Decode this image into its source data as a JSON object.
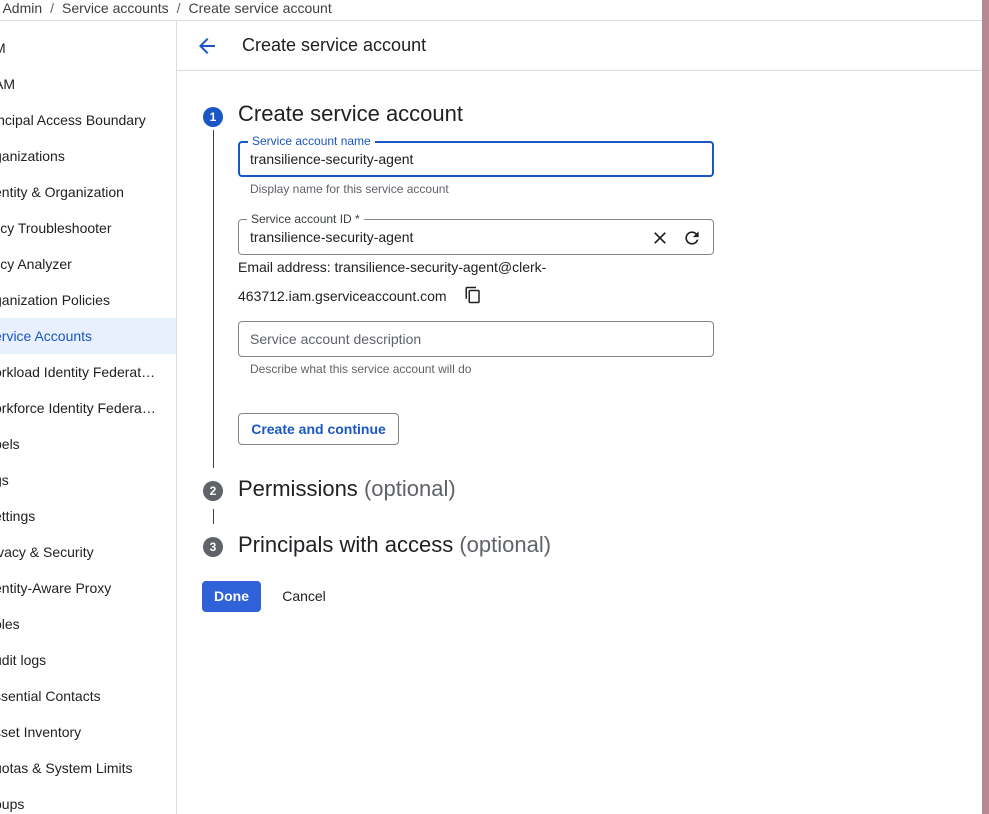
{
  "breadcrumb": {
    "items": [
      "& Admin",
      "Service accounts",
      "Create service account"
    ],
    "separator": "/"
  },
  "sidebar": {
    "items": [
      {
        "label": "M",
        "active": false
      },
      {
        "label": "AM",
        "active": false
      },
      {
        "label": "incipal Access Boundary",
        "active": false
      },
      {
        "label": "ganizations",
        "active": false
      },
      {
        "label": "entity & Organization",
        "active": false
      },
      {
        "label": "licy Troubleshooter",
        "active": false
      },
      {
        "label": "licy Analyzer",
        "active": false
      },
      {
        "label": "ganization Policies",
        "active": false
      },
      {
        "label": "ervice Accounts",
        "active": true
      },
      {
        "label": "orkload Identity Federat…",
        "active": false
      },
      {
        "label": "orkforce Identity Federa…",
        "active": false
      },
      {
        "label": "bels",
        "active": false
      },
      {
        "label": "gs",
        "active": false
      },
      {
        "label": "ettings",
        "active": false
      },
      {
        "label": "ivacy & Security",
        "active": false
      },
      {
        "label": "entity-Aware Proxy",
        "active": false
      },
      {
        "label": "oles",
        "active": false
      },
      {
        "label": "udit logs",
        "active": false
      },
      {
        "label": "ssential Contacts",
        "active": false
      },
      {
        "label": "sset Inventory",
        "active": false
      },
      {
        "label": "uotas & System Limits",
        "active": false
      },
      {
        "label": "oups",
        "active": false
      }
    ]
  },
  "header": {
    "back_icon": "arrow-back-icon",
    "title": "Create service account"
  },
  "steps": [
    {
      "number": "1",
      "title": "Create service account",
      "optional": "",
      "active": true
    },
    {
      "number": "2",
      "title": "Permissions",
      "optional": "(optional)",
      "active": false
    },
    {
      "number": "3",
      "title": "Principals with access",
      "optional": "(optional)",
      "active": false
    }
  ],
  "form": {
    "name_field": {
      "label": "Service account name",
      "value": "transilience-security-agent",
      "hint": "Display name for this service account"
    },
    "id_field": {
      "label": "Service account ID *",
      "value": "transilience-security-agent",
      "clear_icon": "close-icon",
      "regenerate_icon": "refresh-icon"
    },
    "email": {
      "line1": "Email address: transilience-security-agent@clerk-",
      "line2": "463712.iam.gserviceaccount.com",
      "copy_icon": "copy-icon"
    },
    "description_field": {
      "placeholder": "Service account description",
      "value": "",
      "hint": "Describe what this service account will do"
    },
    "create_continue_label": "Create and continue"
  },
  "footer": {
    "done_label": "Done",
    "cancel_label": "Cancel"
  },
  "colors": {
    "accent": "#1a56c4",
    "primary_button": "#2f62d8",
    "active_nav_bg": "#e8f0fe"
  }
}
